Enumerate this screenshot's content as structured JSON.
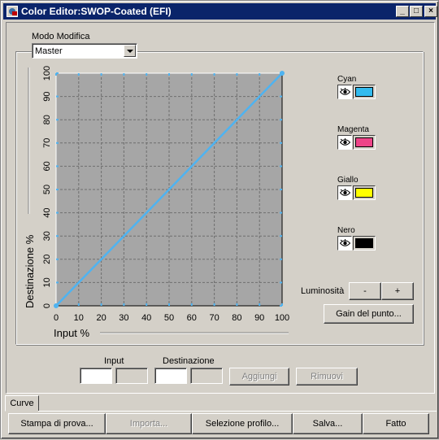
{
  "window": {
    "title": "Color Editor:SWOP-Coated (EFI)",
    "minimize_symbol": "_",
    "maximize_symbol": "□",
    "close_symbol": "×"
  },
  "mode": {
    "label": "Modo Modifica",
    "selected": "Master"
  },
  "chart_data": {
    "type": "line",
    "xlabel": "Input %",
    "ylabel": "Destinazione %",
    "xlim": [
      0,
      100
    ],
    "ylim": [
      0,
      100
    ],
    "xticks": [
      "0",
      "10",
      "20",
      "30",
      "40",
      "50",
      "60",
      "70",
      "80",
      "90",
      "100"
    ],
    "yticks": [
      "0",
      "10",
      "20",
      "30",
      "40",
      "50",
      "60",
      "70",
      "80",
      "90",
      "100"
    ],
    "grid": true,
    "series": [
      {
        "color": "#4fb3f0",
        "x": [
          0,
          100
        ],
        "y": [
          0,
          100
        ]
      }
    ]
  },
  "channels": [
    {
      "name": "Cyan",
      "color": "#33bbee"
    },
    {
      "name": "Magenta",
      "color": "#ee4488"
    },
    {
      "name": "Giallo",
      "color": "#ffff00"
    },
    {
      "name": "Nero",
      "color": "#000000"
    }
  ],
  "luminosity": {
    "label": "Luminosità",
    "minus": "-",
    "plus": "+"
  },
  "gain_button": "Gain del punto...",
  "point_entry": {
    "input_label": "Input",
    "destination_label": "Destinazione",
    "add_button": "Aggiungi",
    "remove_button": "Rimuovi"
  },
  "tab": "Curve",
  "footer": {
    "proof": "Stampa di prova...",
    "import": "Importa...",
    "profile": "Selezione profilo...",
    "save": "Salva...",
    "done": "Fatto"
  }
}
